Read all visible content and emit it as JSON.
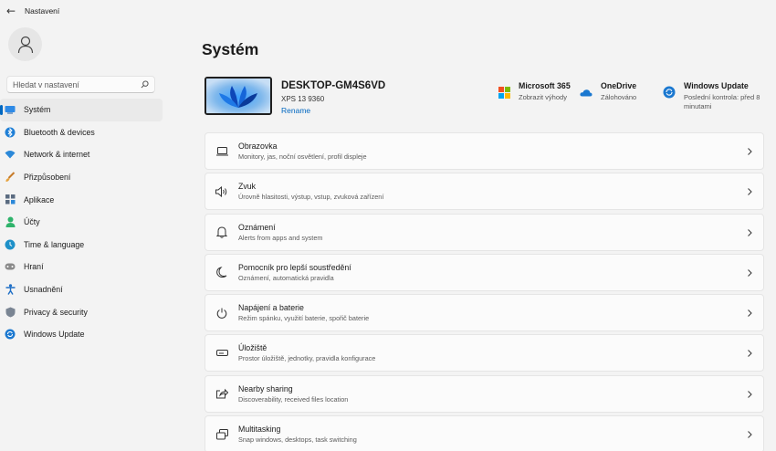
{
  "window": {
    "title": "Nastavení",
    "back_icon": "arrow-left-icon"
  },
  "search": {
    "placeholder": "Hledat v nastavení"
  },
  "sidebar": {
    "items": [
      {
        "label": "Systém",
        "icon": "system-icon",
        "selected": true
      },
      {
        "label": "Bluetooth & devices",
        "icon": "bluetooth-icon"
      },
      {
        "label": "Network & internet",
        "icon": "wifi-icon"
      },
      {
        "label": "Přizpůsobení",
        "icon": "brush-icon"
      },
      {
        "label": "Aplikace",
        "icon": "apps-icon"
      },
      {
        "label": "Účty",
        "icon": "account-icon"
      },
      {
        "label": "Time & language",
        "icon": "globe-clock-icon"
      },
      {
        "label": "Hraní",
        "icon": "gamepad-icon"
      },
      {
        "label": "Usnadnění",
        "icon": "accessibility-icon"
      },
      {
        "label": "Privacy & security",
        "icon": "shield-icon"
      },
      {
        "label": "Windows Update",
        "icon": "update-icon"
      }
    ]
  },
  "main": {
    "title": "Systém",
    "device": {
      "name": "DESKTOP-GM4S6VD",
      "model": "XPS 13 9360",
      "rename_label": "Rename"
    },
    "quick": [
      {
        "title": "Microsoft 365",
        "subtitle": "Zobrazit výhody",
        "icon": "microsoft-logo-icon"
      },
      {
        "title": "OneDrive",
        "subtitle": "Zálohováno",
        "icon": "onedrive-cloud-icon"
      },
      {
        "title": "Windows Update",
        "subtitle": "Poslední kontrola: před 8 minutami",
        "icon": "windows-update-icon"
      }
    ],
    "cards": [
      {
        "title": "Obrazovka",
        "subtitle": "Monitory, jas, noční osvětlení, profil displeje",
        "icon": "display-icon"
      },
      {
        "title": "Zvuk",
        "subtitle": "Úrovně hlasitosti, výstup, vstup, zvuková zařízení",
        "icon": "speaker-icon"
      },
      {
        "title": "Oznámení",
        "subtitle": "Alerts from apps and system",
        "icon": "bell-icon"
      },
      {
        "title": "Pomocník pro lepší soustředění",
        "subtitle": "Oznámení, automatická pravidla",
        "icon": "moon-icon"
      },
      {
        "title": "Napájení a baterie",
        "subtitle": "Režim spánku, využití baterie, spořič baterie",
        "icon": "power-icon"
      },
      {
        "title": "Úložiště",
        "subtitle": "Prostor úložiště, jednotky, pravidla konfigurace",
        "icon": "storage-icon"
      },
      {
        "title": "Nearby sharing",
        "subtitle": "Discoverability, received files location",
        "icon": "share-icon"
      },
      {
        "title": "Multitasking",
        "subtitle": "Snap windows, desktops, task switching",
        "icon": "multitasking-icon"
      }
    ]
  },
  "colors": {
    "accent": "#0067c0",
    "background": "#f3f3f3",
    "card": "#fbfbfb"
  }
}
